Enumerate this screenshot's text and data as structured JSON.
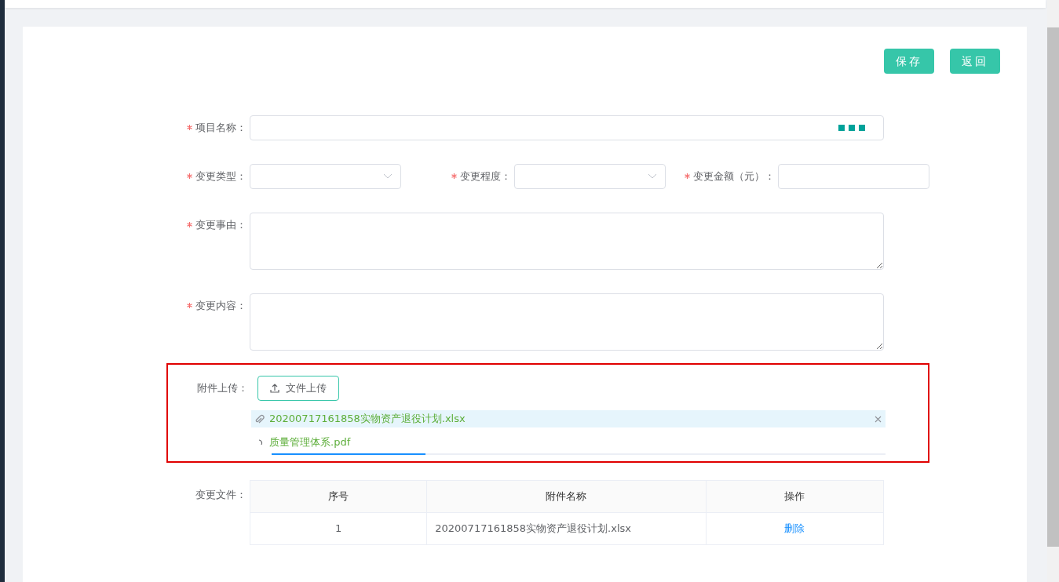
{
  "actions": [
    {
      "label": "保存"
    },
    {
      "label": "返回"
    }
  ],
  "form_rows": [
    [
      {
        "label": "项目名称：",
        "required": true,
        "kind": "picker"
      }
    ],
    [
      {
        "label": "变更类型：",
        "required": true,
        "kind": "select"
      },
      {
        "label": "变更程度：",
        "required": true,
        "kind": "select"
      },
      {
        "label": "变更金额（元）：",
        "required": true,
        "kind": "input"
      }
    ],
    [
      {
        "label": "变更事由：",
        "required": true,
        "kind": "textarea"
      }
    ],
    [
      {
        "label": "变更内容：",
        "required": true,
        "kind": "textarea"
      }
    ]
  ],
  "upload": {
    "label": "附件上传：",
    "button": "文件上传",
    "highlighted": true,
    "files": [
      {
        "name": "20200717161858实物资产退役计划.xlsx",
        "uploading": false,
        "hovered": true
      },
      {
        "name": "质量管理体系.pdf",
        "uploading": true,
        "hovered": false,
        "level": 0.25
      }
    ]
  },
  "change_files": {
    "label": "变更文件：",
    "columns": [
      "序号",
      "附件名称",
      "操作"
    ],
    "rows": [
      {
        "index": "1",
        "name": "20200717161858实物资产退役计划.xlsx",
        "action": "删除"
      }
    ]
  }
}
